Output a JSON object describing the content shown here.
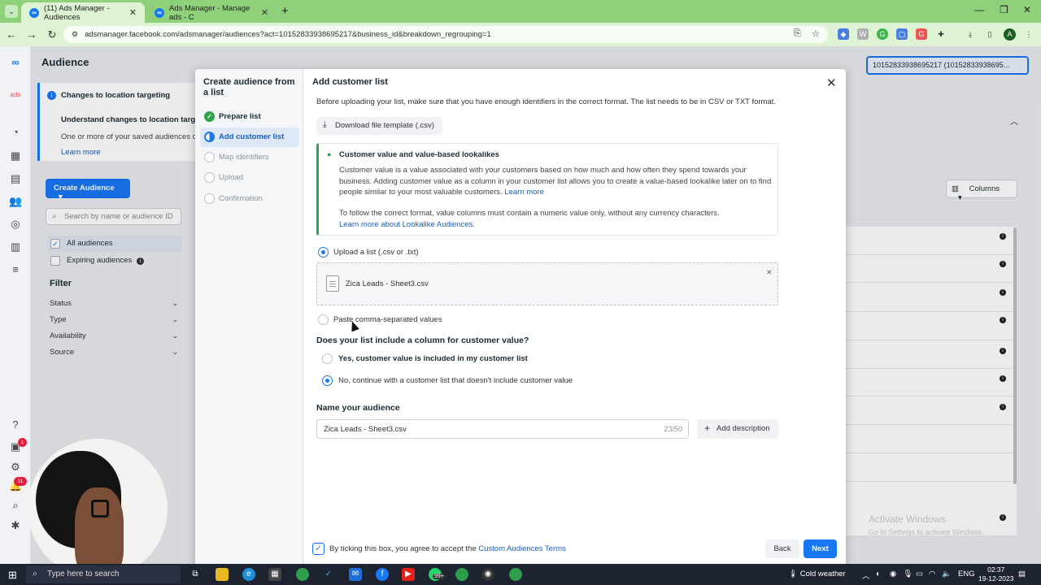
{
  "browser": {
    "tabs": [
      {
        "label": "(11) Ads Manager - Audiences",
        "active": true
      },
      {
        "label": "Ads Manager - Manage ads - C",
        "active": false
      }
    ],
    "url": "adsmanager.facebook.com/adsmanager/audiences?act=10152833938695217&business_id&breakdown_regrouping=1",
    "profile_initial": "A",
    "accent_color": "#8fd17a"
  },
  "page": {
    "title": "Audience",
    "account_selector": "10152833938695217 (10152833938695...",
    "notice": {
      "title": "Changes to location targeting",
      "subtitle": "Understand changes to location targeting",
      "body": "One or more of your saved audiences co",
      "link": "Learn more"
    },
    "create_button": "Create Audience",
    "search_placeholder": "Search by name or audience ID",
    "options": [
      {
        "label": "All audiences",
        "checked": true
      },
      {
        "label": "Expiring audiences",
        "checked": false
      }
    ],
    "filter_heading": "Filter",
    "filters": [
      "Status",
      "Type",
      "Availability",
      "Source"
    ],
    "columns_button": "Columns",
    "rail_badges": [
      "1",
      "11"
    ],
    "watermark_title": "Activate Windows",
    "watermark_sub": "Go to Settings to activate Windows."
  },
  "modal": {
    "sidebar_title": "Create audience from a list",
    "steps": [
      {
        "label": "Prepare list",
        "state": "done"
      },
      {
        "label": "Add customer list",
        "state": "current"
      },
      {
        "label": "Map identifiers",
        "state": "pending"
      },
      {
        "label": "Upload",
        "state": "pending"
      },
      {
        "label": "Confirmation",
        "state": "pending"
      }
    ],
    "heading": "Add customer list",
    "intro": "Before uploading your list, make sure that you have enough identifiers in the correct format. The list needs to be in CSV or TXT format.",
    "download_button": "Download file template (.csv)",
    "value_notice": {
      "title": "Customer value and value-based lookalikes",
      "body": "Customer value is a value associated with your customers based on how much and how often they spend towards your business. Adding customer value as a column in your customer list allows you to create a value-based lookalike later on to find people similar to your most valuable customers.",
      "body_link": "Learn more",
      "body2": "To follow the correct format, value columns must contain a numeric value only, without any currency characters.",
      "body2_link": "Learn more about Lookalike Audiences."
    },
    "upload_option": "Upload a list (.csv or .txt)",
    "uploaded_file": "Zica Leads - Sheet3.csv",
    "paste_option": "Paste comma-separated values",
    "value_question": "Does your list include a column for customer value?",
    "value_yes": "Yes, customer value is included in my customer list",
    "value_no": "No, continue with a customer list that doesn't include customer value",
    "name_heading": "Name your audience",
    "audience_name": "Zica Leads - Sheet3.csv",
    "name_counter": "23/50",
    "add_description": "Add description",
    "terms_prefix": "By ticking this box, you agree to accept the",
    "terms_link": "Custom Audiences Terms",
    "back_button": "Back",
    "next_button": "Next"
  },
  "taskbar": {
    "search_placeholder": "Type here to search",
    "weather": "Cold weather",
    "language": "ENG",
    "time": "02:37",
    "date": "19-12-2023",
    "whatsapp_badge": "99+"
  }
}
